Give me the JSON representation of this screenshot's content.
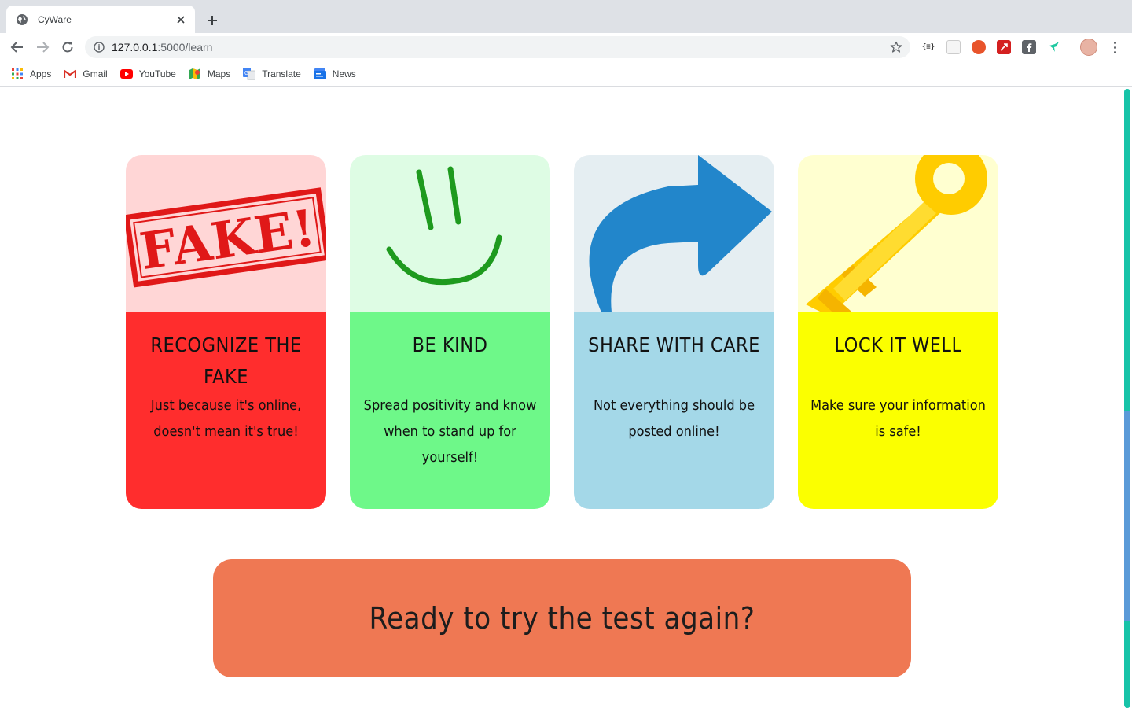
{
  "browser": {
    "tab_title": "CyWare",
    "url_host": "127.0.0.1",
    "url_path": ":5000/learn",
    "bookmarks": [
      {
        "label": "Apps",
        "icon": "apps-grid-icon"
      },
      {
        "label": "Gmail",
        "icon": "gmail-icon"
      },
      {
        "label": "YouTube",
        "icon": "youtube-icon"
      },
      {
        "label": "Maps",
        "icon": "maps-icon"
      },
      {
        "label": "Translate",
        "icon": "translate-icon"
      },
      {
        "label": "News",
        "icon": "news-icon"
      }
    ],
    "extension_badge": "{≡}"
  },
  "cards": [
    {
      "title": "RECOGNIZE THE FAKE",
      "text": "Just because it's online, doesn't mean it's true!",
      "image": "fake-stamp",
      "stamp_text": "FAKE!",
      "colors": {
        "top": "#ffd6d6",
        "bottom": "#ff2d2d"
      }
    },
    {
      "title": "BE KIND",
      "text": "Spread positivity and know when to stand up for yourself!",
      "image": "smiley-face",
      "colors": {
        "top": "#defce4",
        "bottom": "#6ef889"
      }
    },
    {
      "title": "SHARE WITH CARE",
      "text": "Not everything should be posted online!",
      "image": "share-arrow",
      "colors": {
        "top": "#e5eef2",
        "bottom": "#a4d8e8"
      }
    },
    {
      "title": "LOCK IT WELL",
      "text": "Make sure your information is safe!",
      "image": "golden-key",
      "colors": {
        "top": "#ffffd0",
        "bottom": "#fbff00"
      }
    }
  ],
  "cta": {
    "label": "Ready to try the test again?",
    "color": "#ef7853"
  }
}
